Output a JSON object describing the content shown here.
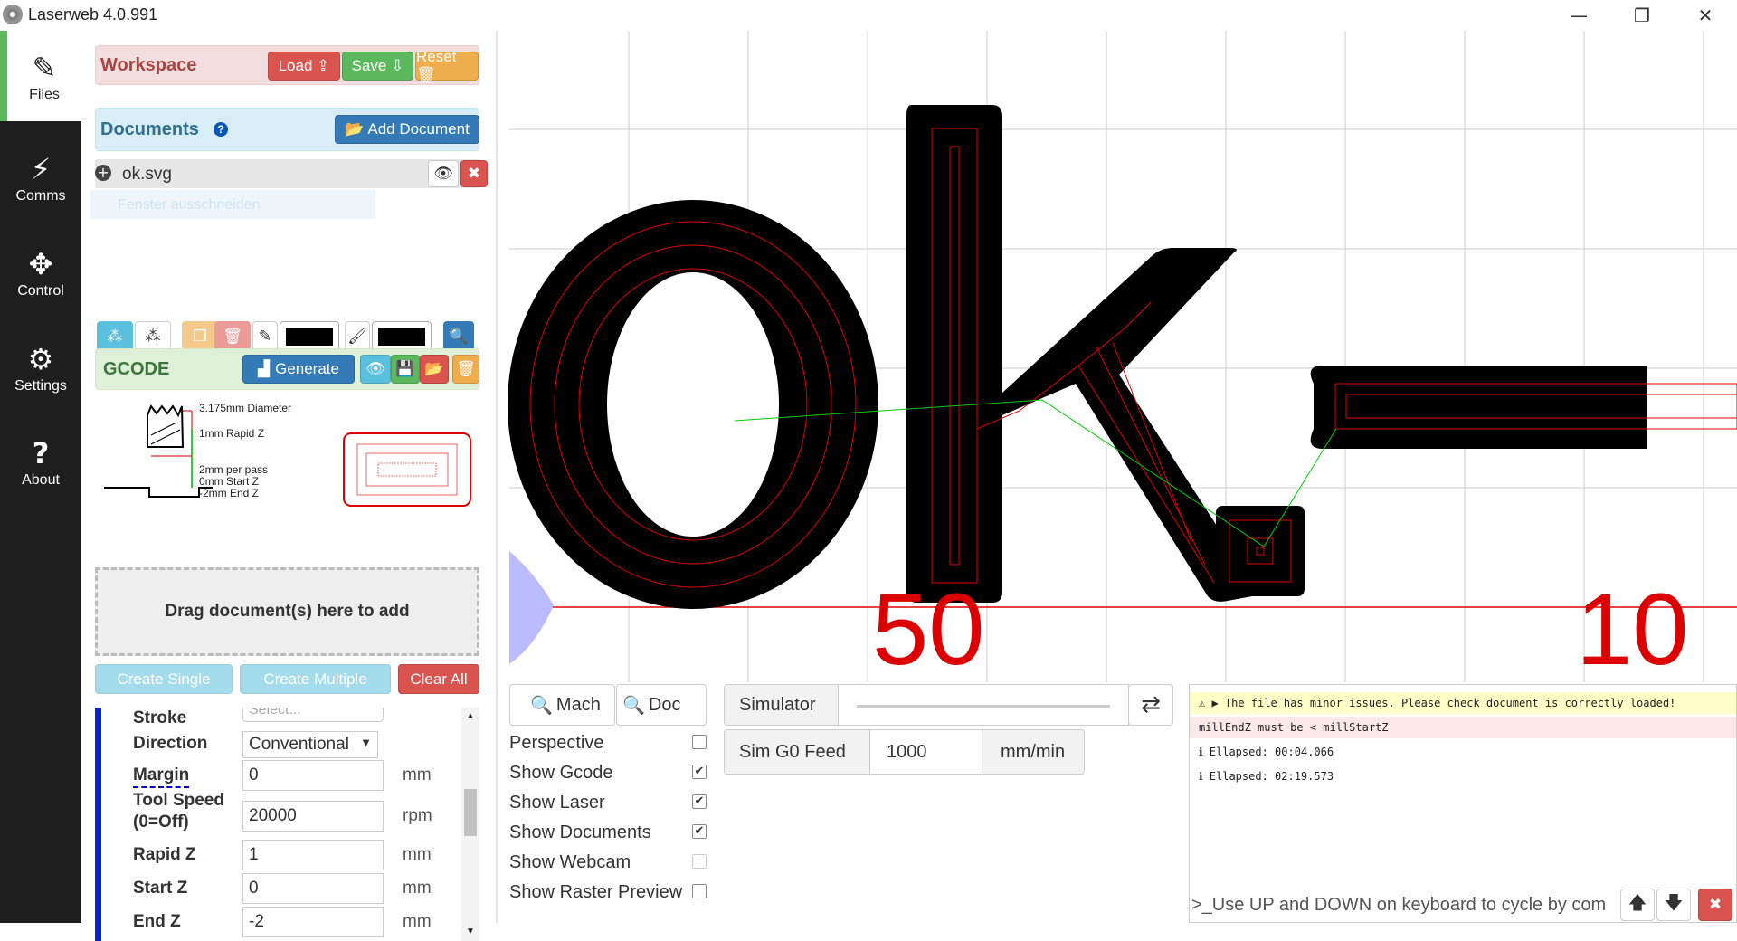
{
  "window": {
    "title": "Laserweb 4.0.991",
    "minimize": "—",
    "restore": "❐",
    "close": "✕"
  },
  "nav": [
    {
      "label": "Files",
      "icon": "✎"
    },
    {
      "label": "Comms",
      "icon": "⚡"
    },
    {
      "label": "Control",
      "icon": "✥"
    },
    {
      "label": "Settings",
      "icon": "⚙"
    },
    {
      "label": "About",
      "icon": "?"
    }
  ],
  "workspace": {
    "title": "Workspace",
    "load": "Load ⇪",
    "save": "Save ⇩",
    "reset": "Reset 🗑"
  },
  "documents": {
    "title": "Documents",
    "help": "?",
    "add": "Add Document",
    "items": [
      {
        "name": "ok.svg",
        "ghost": "Fenster ausschneiden"
      }
    ]
  },
  "gcode": {
    "title": "GCODE",
    "generate": "Generate"
  },
  "diagram": {
    "diameter": "3.175mm Diameter",
    "rapidz": "1mm Rapid Z",
    "perpass": "2mm per pass",
    "startz": "0mm Start Z",
    "endz": "-2mm End Z"
  },
  "dropzone": "Drag document(s) here to add",
  "ops": {
    "create_single": "Create Single",
    "create_multiple": "Create Multiple",
    "clear_all": "Clear All"
  },
  "props": {
    "stroke_label": "Stroke",
    "stroke_placeholder": "Select...",
    "direction_label": "Direction",
    "direction_value": "Conventional",
    "margin_label": "Margin",
    "margin_value": "0",
    "margin_unit": "mm",
    "speed_label": "Tool Speed (0=Off)",
    "speed_value": "20000",
    "speed_unit": "rpm",
    "rapidz_label": "Rapid Z",
    "rapidz_value": "1",
    "rapidz_unit": "mm",
    "startz_label": "Start Z",
    "startz_value": "0",
    "startz_unit": "mm",
    "endz_label": "End Z",
    "endz_value": "-2",
    "endz_unit": "mm"
  },
  "canvas": {
    "text": "ok.–",
    "axis_50": "50",
    "axis_100": "10"
  },
  "controls": {
    "mach": "Mach",
    "doc": "Doc",
    "simulator": "Simulator",
    "sim_feed_label": "Sim G0 Feed",
    "sim_feed_value": "1000",
    "sim_feed_unit": "mm/min",
    "perspective": "Perspective",
    "show_gcode": "Show Gcode",
    "show_laser": "Show Laser",
    "show_documents": "Show Documents",
    "show_webcam": "Show Webcam",
    "show_raster": "Show Raster Preview",
    "check": "✔"
  },
  "console": {
    "warning": "⚠ ▶ The file has minor issues. Please check document is correctly loaded!",
    "error": "millEndZ must be < millStartZ",
    "log1": "ℹ Ellapsed: 00:04.066",
    "log2": "ℹ Ellapsed: 02:19.573",
    "input_placeholder": ">_Use UP and DOWN on keyboard to cycle by com"
  }
}
